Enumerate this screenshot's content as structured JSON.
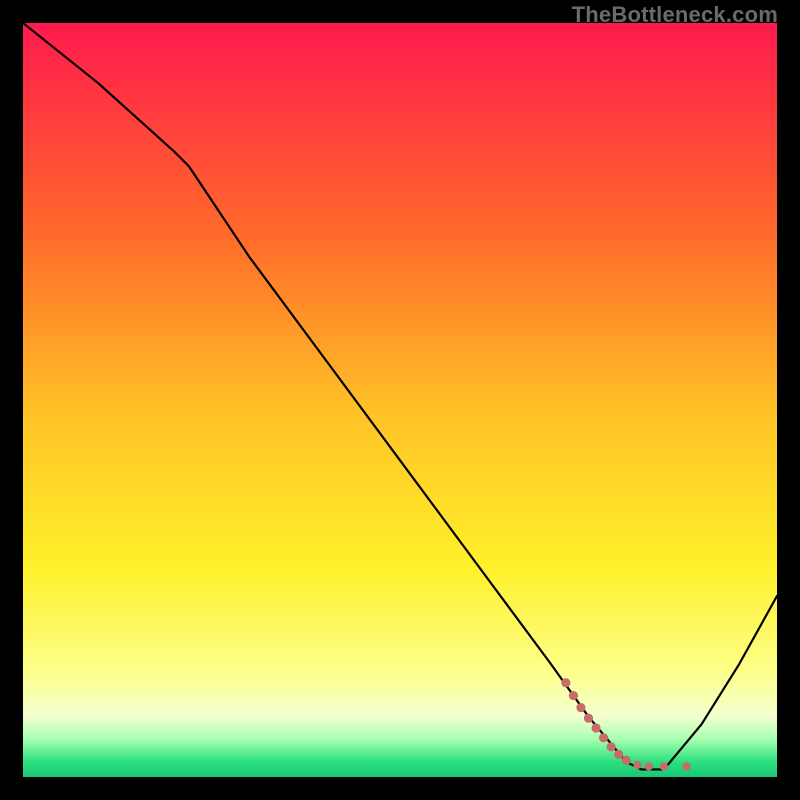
{
  "watermark": "TheBottleneck.com",
  "colors": {
    "frame": "#000000",
    "grad_top": "#ff1a4d",
    "grad_mid1": "#ff6a2a",
    "grad_mid2": "#ffc326",
    "grad_mid3": "#fff02a",
    "grad_mid4": "#fdff8a",
    "grad_light": "#f3ffd0",
    "grad_green1": "#a6ffb0",
    "grad_green2": "#2be07e",
    "grad_bottom": "#19c776",
    "curve": "#000000",
    "dots": "#c96b66"
  },
  "chart_data": {
    "type": "line",
    "title": "",
    "xlabel": "",
    "ylabel": "",
    "xlim": [
      0,
      100
    ],
    "ylim": [
      0,
      100
    ],
    "series": [
      {
        "name": "bottleneck-curve",
        "x": [
          0,
          10,
          20,
          22,
          30,
          40,
          50,
          60,
          70,
          75,
          80,
          82,
          85,
          90,
          95,
          100
        ],
        "y": [
          100,
          92,
          83,
          81,
          69,
          55.5,
          42,
          28.5,
          15,
          8,
          2,
          1,
          1,
          7,
          15,
          24
        ]
      }
    ],
    "dotted_annotation": {
      "name": "highlight-region",
      "points": [
        {
          "x": 72,
          "y": 12.5
        },
        {
          "x": 73,
          "y": 10.8
        },
        {
          "x": 74,
          "y": 9.2
        },
        {
          "x": 75,
          "y": 7.8
        },
        {
          "x": 76,
          "y": 6.5
        },
        {
          "x": 77,
          "y": 5.2
        },
        {
          "x": 78,
          "y": 4.0
        },
        {
          "x": 79,
          "y": 3.0
        },
        {
          "x": 80,
          "y": 2.2
        },
        {
          "x": 81.5,
          "y": 1.6
        },
        {
          "x": 83,
          "y": 1.4
        },
        {
          "x": 85,
          "y": 1.4
        },
        {
          "x": 88,
          "y": 1.4
        }
      ]
    }
  }
}
